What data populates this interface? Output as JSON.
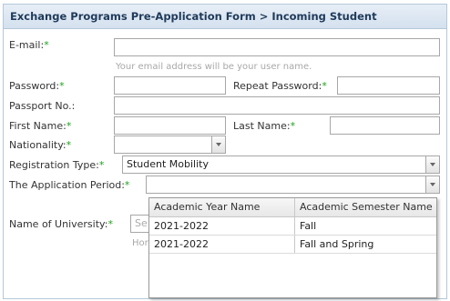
{
  "form": {
    "title": "Exchange Programs Pre-Application Form > Incoming Student",
    "required_mark": "*",
    "email": {
      "label": "E-mail:",
      "value": "",
      "hint": "Your email address will be your user name."
    },
    "password": {
      "label": "Password:",
      "value": ""
    },
    "repeat_password": {
      "label": "Repeat Password:",
      "value": ""
    },
    "passport": {
      "label": "Passport No.:",
      "value": ""
    },
    "first_name": {
      "label": "First Name:",
      "value": ""
    },
    "last_name": {
      "label": "Last Name:",
      "value": ""
    },
    "nationality": {
      "label": "Nationality:",
      "value": ""
    },
    "registration_type": {
      "label": "Registration Type:",
      "value": "Student Mobility"
    },
    "application_period": {
      "label": "The Application Period:",
      "value": ""
    },
    "university": {
      "label": "Name of University:",
      "value_visible": "Se",
      "hint_visible": "Hor"
    }
  },
  "dropdown": {
    "columns": [
      "Academic Year Name",
      "Academic Semester Name"
    ],
    "rows": [
      [
        "2021-2022",
        "Fall"
      ],
      [
        "2021-2022",
        "Fall and Spring"
      ]
    ]
  }
}
